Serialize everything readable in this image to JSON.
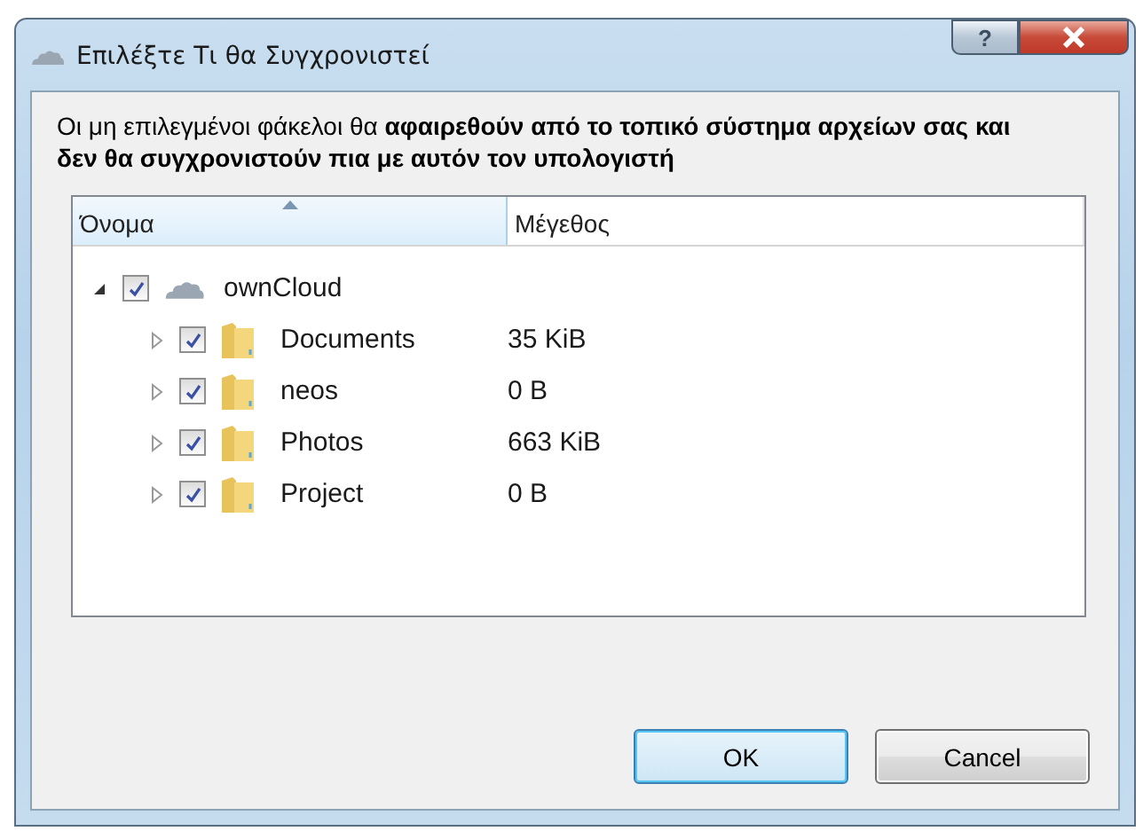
{
  "window": {
    "title": "Επιλέξτε Τι θα Συγχρονιστεί",
    "help_button": "?"
  },
  "description": "Οι μη επιλεγμένοι φάκελοι θα **αφαιρεθούν από το τοπικό σύστημα αρχείων σας και δεν θα συγχρονιστούν πια με αυτόν τον υπολογιστή**",
  "tree": {
    "columns": [
      {
        "label": "Όνομα",
        "sorted": true
      },
      {
        "label": "Μέγεθος",
        "sorted": false
      }
    ],
    "items": [
      {
        "kind": "account",
        "name": "ownCloud",
        "checked": true,
        "expanded": true,
        "children": [
          {
            "kind": "folder",
            "name": "Documents",
            "size": "35 KiB",
            "checked": true,
            "expanded": false
          },
          {
            "kind": "folder",
            "name": "neos",
            "size": "0 B",
            "checked": true,
            "expanded": false
          },
          {
            "kind": "folder",
            "name": "Photos",
            "size": "663 KiB",
            "checked": true,
            "expanded": false
          },
          {
            "kind": "folder",
            "name": "Project",
            "size": "0 B",
            "checked": true,
            "expanded": false
          }
        ]
      }
    ]
  },
  "buttons": [
    {
      "label": "OK",
      "default": true
    },
    {
      "label": "Cancel",
      "default": false
    }
  ]
}
